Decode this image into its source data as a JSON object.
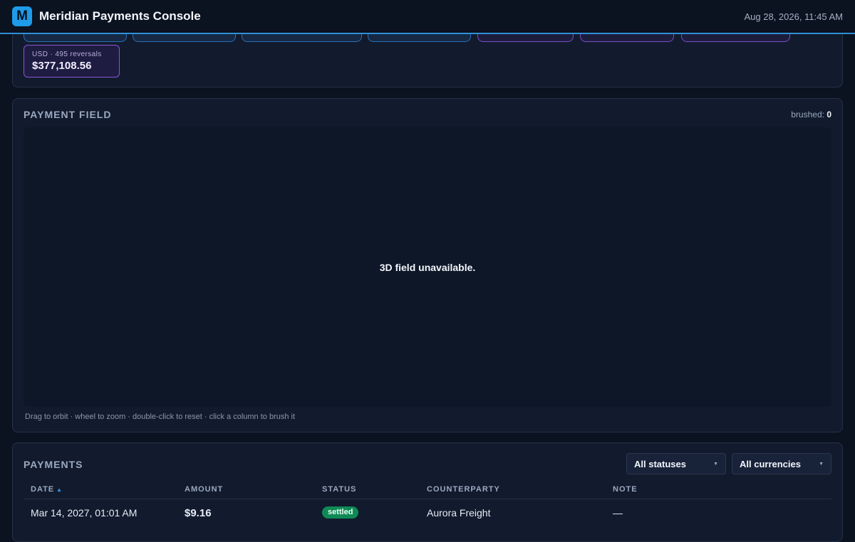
{
  "header": {
    "logo_letter": "M",
    "title": "Meridian Payments Console",
    "datetime": "Aug 28, 2026, 11:45 AM"
  },
  "summary": {
    "reversal_card": {
      "subtitle": "USD · 495 reversals",
      "amount": "$377,108.56"
    }
  },
  "field": {
    "title": "PAYMENT FIELD",
    "brushed_label": "brushed:",
    "brushed_count": "0",
    "unavailable_message": "3D field unavailable.",
    "hint": "Drag to orbit · wheel to zoom · double-click to reset · click a column to brush it"
  },
  "payments": {
    "title": "PAYMENTS",
    "status_filter": "All statuses",
    "currency_filter": "All currencies",
    "columns": {
      "date": "DATE",
      "amount": "AMOUNT",
      "status": "STATUS",
      "counterparty": "COUNTERPARTY",
      "note": "NOTE"
    },
    "rows": [
      {
        "date": "Mar 14, 2027, 01:01 AM",
        "amount": "$9.16",
        "status": "settled",
        "counterparty": "Aurora Freight",
        "note": "—"
      }
    ]
  },
  "colors": {
    "accent": "#1e9be9",
    "settled": "#0f8a56",
    "reversal": "#8a54d6"
  }
}
